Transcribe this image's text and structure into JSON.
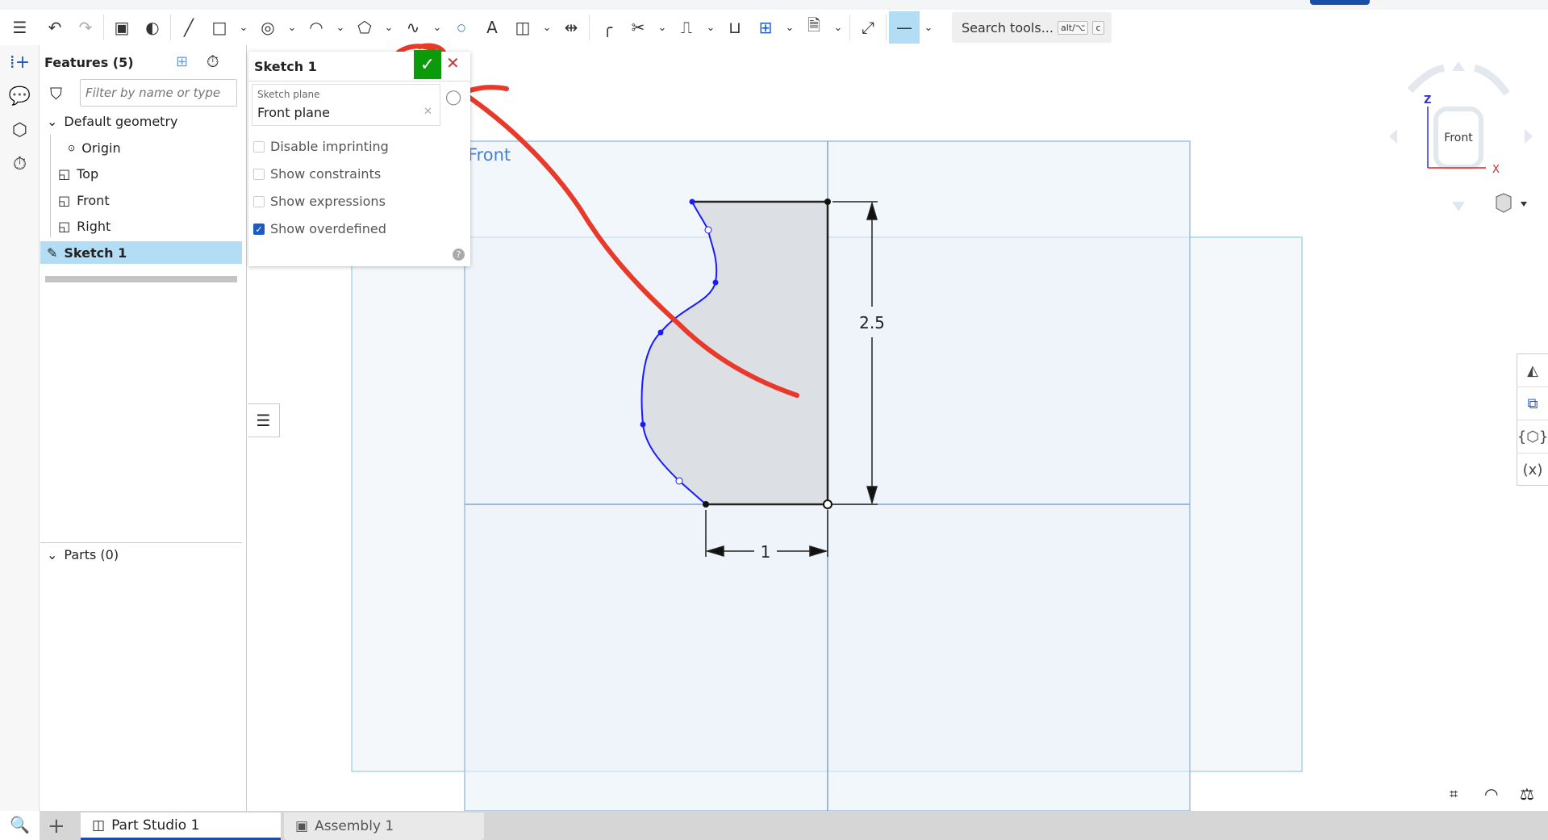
{
  "toolbar": {
    "search_label": "Search tools...",
    "shortcut_1": "alt/⌥",
    "shortcut_2": "c",
    "icons": [
      "undo-icon",
      "redo-icon",
      "sketch-icon",
      "appearance-icon",
      "line-icon",
      "rectangle-icon",
      "circle-icon",
      "arc-icon",
      "polygon-icon",
      "spline-icon",
      "point-icon",
      "text-icon",
      "construction-icon",
      "mirror-icon",
      "fillet-icon",
      "trim-icon",
      "offset-icon",
      "use-icon",
      "pattern-icon",
      "dxf-icon",
      "dimension-icon",
      "line-style-icon"
    ]
  },
  "features": {
    "title": "Features (5)",
    "filter_placeholder": "Filter by name or type",
    "default_geometry": "Default geometry",
    "items": [
      "Origin",
      "Top",
      "Front",
      "Right"
    ],
    "sketch": "Sketch 1",
    "parts": "Parts (0)"
  },
  "dialog": {
    "title": "Sketch 1",
    "plane_label": "Sketch plane",
    "plane_value": "Front plane",
    "options": [
      {
        "label": "Disable imprinting",
        "checked": false
      },
      {
        "label": "Show constraints",
        "checked": false
      },
      {
        "label": "Show expressions",
        "checked": false
      },
      {
        "label": "Show overdefined",
        "checked": true
      }
    ]
  },
  "canvas": {
    "plane_label": "Front",
    "dim_height": "2.5",
    "dim_width": "1",
    "viewcube_label": "Front",
    "axis_z": "Z",
    "axis_x": "X"
  },
  "tabs": [
    {
      "label": "Part Studio 1",
      "active": true
    },
    {
      "label": "Assembly 1",
      "active": false
    }
  ],
  "colors": {
    "accent": "#1a4fa8",
    "confirm": "#0a9a0a",
    "annotation": "#e8392b",
    "selection": "#b3ddf5",
    "sketch": "#1a1aff"
  }
}
